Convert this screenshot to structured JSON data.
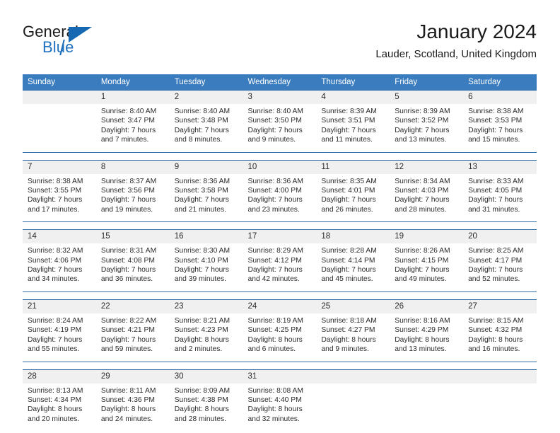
{
  "brand": {
    "name_part1": "General",
    "name_part2": "Blue"
  },
  "header": {
    "month_title": "January 2024",
    "location": "Lauder, Scotland, United Kingdom"
  },
  "colors": {
    "header_blue": "#3a7cbe",
    "separator_blue": "#2f6ca8",
    "daynum_band": "#f0f0f0",
    "brand_blue": "#1f72c0",
    "text": "#2b2b2b"
  },
  "weekday_headers": [
    "Sunday",
    "Monday",
    "Tuesday",
    "Wednesday",
    "Thursday",
    "Friday",
    "Saturday"
  ],
  "weeks": [
    [
      {
        "day": "",
        "empty": true,
        "sunrise": "",
        "sunset": "",
        "daylight_line1": "",
        "daylight_line2": ""
      },
      {
        "day": "1",
        "sunrise": "Sunrise: 8:40 AM",
        "sunset": "Sunset: 3:47 PM",
        "daylight_line1": "Daylight: 7 hours",
        "daylight_line2": "and 7 minutes."
      },
      {
        "day": "2",
        "sunrise": "Sunrise: 8:40 AM",
        "sunset": "Sunset: 3:48 PM",
        "daylight_line1": "Daylight: 7 hours",
        "daylight_line2": "and 8 minutes."
      },
      {
        "day": "3",
        "sunrise": "Sunrise: 8:40 AM",
        "sunset": "Sunset: 3:50 PM",
        "daylight_line1": "Daylight: 7 hours",
        "daylight_line2": "and 9 minutes."
      },
      {
        "day": "4",
        "sunrise": "Sunrise: 8:39 AM",
        "sunset": "Sunset: 3:51 PM",
        "daylight_line1": "Daylight: 7 hours",
        "daylight_line2": "and 11 minutes."
      },
      {
        "day": "5",
        "sunrise": "Sunrise: 8:39 AM",
        "sunset": "Sunset: 3:52 PM",
        "daylight_line1": "Daylight: 7 hours",
        "daylight_line2": "and 13 minutes."
      },
      {
        "day": "6",
        "sunrise": "Sunrise: 8:38 AM",
        "sunset": "Sunset: 3:53 PM",
        "daylight_line1": "Daylight: 7 hours",
        "daylight_line2": "and 15 minutes."
      }
    ],
    [
      {
        "day": "7",
        "sunrise": "Sunrise: 8:38 AM",
        "sunset": "Sunset: 3:55 PM",
        "daylight_line1": "Daylight: 7 hours",
        "daylight_line2": "and 17 minutes."
      },
      {
        "day": "8",
        "sunrise": "Sunrise: 8:37 AM",
        "sunset": "Sunset: 3:56 PM",
        "daylight_line1": "Daylight: 7 hours",
        "daylight_line2": "and 19 minutes."
      },
      {
        "day": "9",
        "sunrise": "Sunrise: 8:36 AM",
        "sunset": "Sunset: 3:58 PM",
        "daylight_line1": "Daylight: 7 hours",
        "daylight_line2": "and 21 minutes."
      },
      {
        "day": "10",
        "sunrise": "Sunrise: 8:36 AM",
        "sunset": "Sunset: 4:00 PM",
        "daylight_line1": "Daylight: 7 hours",
        "daylight_line2": "and 23 minutes."
      },
      {
        "day": "11",
        "sunrise": "Sunrise: 8:35 AM",
        "sunset": "Sunset: 4:01 PM",
        "daylight_line1": "Daylight: 7 hours",
        "daylight_line2": "and 26 minutes."
      },
      {
        "day": "12",
        "sunrise": "Sunrise: 8:34 AM",
        "sunset": "Sunset: 4:03 PM",
        "daylight_line1": "Daylight: 7 hours",
        "daylight_line2": "and 28 minutes."
      },
      {
        "day": "13",
        "sunrise": "Sunrise: 8:33 AM",
        "sunset": "Sunset: 4:05 PM",
        "daylight_line1": "Daylight: 7 hours",
        "daylight_line2": "and 31 minutes."
      }
    ],
    [
      {
        "day": "14",
        "sunrise": "Sunrise: 8:32 AM",
        "sunset": "Sunset: 4:06 PM",
        "daylight_line1": "Daylight: 7 hours",
        "daylight_line2": "and 34 minutes."
      },
      {
        "day": "15",
        "sunrise": "Sunrise: 8:31 AM",
        "sunset": "Sunset: 4:08 PM",
        "daylight_line1": "Daylight: 7 hours",
        "daylight_line2": "and 36 minutes."
      },
      {
        "day": "16",
        "sunrise": "Sunrise: 8:30 AM",
        "sunset": "Sunset: 4:10 PM",
        "daylight_line1": "Daylight: 7 hours",
        "daylight_line2": "and 39 minutes."
      },
      {
        "day": "17",
        "sunrise": "Sunrise: 8:29 AM",
        "sunset": "Sunset: 4:12 PM",
        "daylight_line1": "Daylight: 7 hours",
        "daylight_line2": "and 42 minutes."
      },
      {
        "day": "18",
        "sunrise": "Sunrise: 8:28 AM",
        "sunset": "Sunset: 4:14 PM",
        "daylight_line1": "Daylight: 7 hours",
        "daylight_line2": "and 45 minutes."
      },
      {
        "day": "19",
        "sunrise": "Sunrise: 8:26 AM",
        "sunset": "Sunset: 4:15 PM",
        "daylight_line1": "Daylight: 7 hours",
        "daylight_line2": "and 49 minutes."
      },
      {
        "day": "20",
        "sunrise": "Sunrise: 8:25 AM",
        "sunset": "Sunset: 4:17 PM",
        "daylight_line1": "Daylight: 7 hours",
        "daylight_line2": "and 52 minutes."
      }
    ],
    [
      {
        "day": "21",
        "sunrise": "Sunrise: 8:24 AM",
        "sunset": "Sunset: 4:19 PM",
        "daylight_line1": "Daylight: 7 hours",
        "daylight_line2": "and 55 minutes."
      },
      {
        "day": "22",
        "sunrise": "Sunrise: 8:22 AM",
        "sunset": "Sunset: 4:21 PM",
        "daylight_line1": "Daylight: 7 hours",
        "daylight_line2": "and 59 minutes."
      },
      {
        "day": "23",
        "sunrise": "Sunrise: 8:21 AM",
        "sunset": "Sunset: 4:23 PM",
        "daylight_line1": "Daylight: 8 hours",
        "daylight_line2": "and 2 minutes."
      },
      {
        "day": "24",
        "sunrise": "Sunrise: 8:19 AM",
        "sunset": "Sunset: 4:25 PM",
        "daylight_line1": "Daylight: 8 hours",
        "daylight_line2": "and 6 minutes."
      },
      {
        "day": "25",
        "sunrise": "Sunrise: 8:18 AM",
        "sunset": "Sunset: 4:27 PM",
        "daylight_line1": "Daylight: 8 hours",
        "daylight_line2": "and 9 minutes."
      },
      {
        "day": "26",
        "sunrise": "Sunrise: 8:16 AM",
        "sunset": "Sunset: 4:29 PM",
        "daylight_line1": "Daylight: 8 hours",
        "daylight_line2": "and 13 minutes."
      },
      {
        "day": "27",
        "sunrise": "Sunrise: 8:15 AM",
        "sunset": "Sunset: 4:32 PM",
        "daylight_line1": "Daylight: 8 hours",
        "daylight_line2": "and 16 minutes."
      }
    ],
    [
      {
        "day": "28",
        "sunrise": "Sunrise: 8:13 AM",
        "sunset": "Sunset: 4:34 PM",
        "daylight_line1": "Daylight: 8 hours",
        "daylight_line2": "and 20 minutes."
      },
      {
        "day": "29",
        "sunrise": "Sunrise: 8:11 AM",
        "sunset": "Sunset: 4:36 PM",
        "daylight_line1": "Daylight: 8 hours",
        "daylight_line2": "and 24 minutes."
      },
      {
        "day": "30",
        "sunrise": "Sunrise: 8:09 AM",
        "sunset": "Sunset: 4:38 PM",
        "daylight_line1": "Daylight: 8 hours",
        "daylight_line2": "and 28 minutes."
      },
      {
        "day": "31",
        "sunrise": "Sunrise: 8:08 AM",
        "sunset": "Sunset: 4:40 PM",
        "daylight_line1": "Daylight: 8 hours",
        "daylight_line2": "and 32 minutes."
      },
      {
        "day": "",
        "empty": true,
        "sunrise": "",
        "sunset": "",
        "daylight_line1": "",
        "daylight_line2": ""
      },
      {
        "day": "",
        "empty": true,
        "sunrise": "",
        "sunset": "",
        "daylight_line1": "",
        "daylight_line2": ""
      },
      {
        "day": "",
        "empty": true,
        "sunrise": "",
        "sunset": "",
        "daylight_line1": "",
        "daylight_line2": ""
      }
    ]
  ]
}
